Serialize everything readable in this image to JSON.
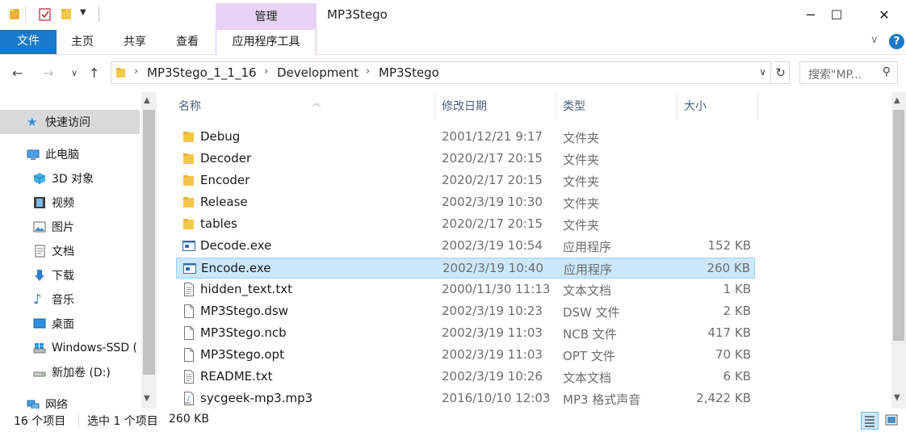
{
  "window": {
    "title": "MP3Stego",
    "context_header": "管理",
    "minimize": "─",
    "maximize": "☐",
    "close": "✕"
  },
  "ribbon": {
    "file_tab": "文件",
    "tabs": [
      "主页",
      "共享",
      "查看"
    ],
    "context_tab": "应用程序工具"
  },
  "address": {
    "crumbs": [
      "MP3Stego_1_1_16",
      "Development",
      "MP3Stego"
    ],
    "search_placeholder": "搜索\"MP..."
  },
  "navpane": {
    "items": [
      {
        "label": "快速访问",
        "icon": "star-icon",
        "selected": true
      },
      {
        "label": "此电脑",
        "icon": "computer-icon"
      },
      {
        "label": "3D 对象",
        "icon": "3d-objects-icon"
      },
      {
        "label": "视频",
        "icon": "video-icon"
      },
      {
        "label": "图片",
        "icon": "pictures-icon"
      },
      {
        "label": "文档",
        "icon": "documents-icon"
      },
      {
        "label": "下载",
        "icon": "download-icon"
      },
      {
        "label": "音乐",
        "icon": "music-icon"
      },
      {
        "label": "桌面",
        "icon": "desktop-icon"
      },
      {
        "label": "Windows-SSD (",
        "icon": "windows-drive-icon"
      },
      {
        "label": "新加卷 (D:)",
        "icon": "drive-icon"
      },
      {
        "label": "网络",
        "icon": "network-icon"
      }
    ]
  },
  "columns": {
    "name": "名称",
    "date": "修改日期",
    "type": "类型",
    "size": "大小"
  },
  "files": [
    {
      "name": "Debug",
      "date": "2001/12/21 9:17",
      "type": "文件夹",
      "size": "",
      "icon": "folder-icon"
    },
    {
      "name": "Decoder",
      "date": "2020/2/17 20:15",
      "type": "文件夹",
      "size": "",
      "icon": "folder-icon"
    },
    {
      "name": "Encoder",
      "date": "2020/2/17 20:15",
      "type": "文件夹",
      "size": "",
      "icon": "folder-icon"
    },
    {
      "name": "Release",
      "date": "2002/3/19 10:30",
      "type": "文件夹",
      "size": "",
      "icon": "folder-icon"
    },
    {
      "name": "tables",
      "date": "2020/2/17 20:15",
      "type": "文件夹",
      "size": "",
      "icon": "folder-icon"
    },
    {
      "name": "Decode.exe",
      "date": "2002/3/19 10:54",
      "type": "应用程序",
      "size": "152 KB",
      "icon": "exe-icon"
    },
    {
      "name": "Encode.exe",
      "date": "2002/3/19 10:40",
      "type": "应用程序",
      "size": "260 KB",
      "icon": "exe-icon",
      "selected": true
    },
    {
      "name": "hidden_text.txt",
      "date": "2000/11/30 11:13",
      "type": "文本文档",
      "size": "1 KB",
      "icon": "text-file-icon"
    },
    {
      "name": "MP3Stego.dsw",
      "date": "2002/3/19 10:23",
      "type": "DSW 文件",
      "size": "2 KB",
      "icon": "file-icon"
    },
    {
      "name": "MP3Stego.ncb",
      "date": "2002/3/19 11:03",
      "type": "NCB 文件",
      "size": "417 KB",
      "icon": "file-icon"
    },
    {
      "name": "MP3Stego.opt",
      "date": "2002/3/19 11:03",
      "type": "OPT 文件",
      "size": "70 KB",
      "icon": "file-icon"
    },
    {
      "name": "README.txt",
      "date": "2002/3/19 10:26",
      "type": "文本文档",
      "size": "6 KB",
      "icon": "text-file-icon"
    },
    {
      "name": "sycgeek-mp3.mp3",
      "date": "2016/10/10 12:03",
      "type": "MP3 格式声音",
      "size": "2,422 KB",
      "icon": "audio-file-icon"
    }
  ],
  "status": {
    "count": "16 个项目",
    "selection": "选中 1 个项目",
    "selection_size": "260 KB"
  },
  "colors": {
    "accent": "#1979ca",
    "selection_bg": "#cce8ff",
    "context_tab": "#e8d3f5",
    "folder": "#f8d775"
  }
}
